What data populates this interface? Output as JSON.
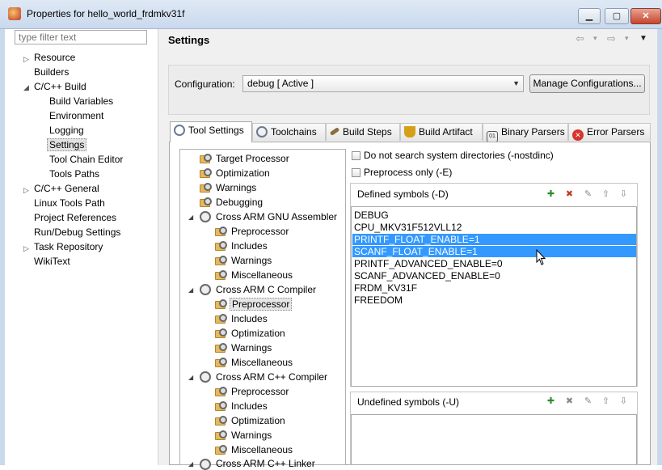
{
  "window": {
    "title": "Properties for hello_world_frdmkv31f",
    "min_glyph": "▁",
    "max_glyph": "▢",
    "close_glyph": "✕"
  },
  "sidebar": {
    "filter_placeholder": "type filter text",
    "items": [
      {
        "label": "Resource",
        "twisty": "▷"
      },
      {
        "label": "Builders"
      },
      {
        "label": "C/C++ Build",
        "twisty": "◢"
      },
      {
        "label": "Build Variables"
      },
      {
        "label": "Environment"
      },
      {
        "label": "Logging"
      },
      {
        "label": "Settings"
      },
      {
        "label": "Tool Chain Editor"
      },
      {
        "label": "Tools Paths"
      },
      {
        "label": "C/C++ General",
        "twisty": "▷"
      },
      {
        "label": "Linux Tools Path"
      },
      {
        "label": "Project References"
      },
      {
        "label": "Run/Debug Settings"
      },
      {
        "label": "Task Repository",
        "twisty": "▷"
      },
      {
        "label": "WikiText"
      }
    ]
  },
  "header": {
    "title": "Settings",
    "back_glyph": "⇦",
    "forward_glyph": "⇨",
    "dropdown_glyph": "▾",
    "menu_glyph": "▼"
  },
  "configuration": {
    "label": "Configuration:",
    "selected": "debug  [ Active ]",
    "manage_label": "Manage Configurations..."
  },
  "tabs": [
    {
      "label": "Tool Settings",
      "icon": "gear-icon",
      "color": "#6b7a8f"
    },
    {
      "label": "Toolchains",
      "icon": "gear-icon",
      "color": "#6b7a8f"
    },
    {
      "label": "Build Steps",
      "icon": "hammer-icon",
      "color": "#8c6d3f"
    },
    {
      "label": "Build Artifact",
      "icon": "trophy-icon",
      "color": "#d4a017"
    },
    {
      "label": "Binary Parsers",
      "icon": "binary-icon",
      "color": "#555555"
    },
    {
      "label": "Error Parsers",
      "icon": "error-icon",
      "color": "#d9342b"
    }
  ],
  "tool_tree": [
    {
      "label": "Target Processor"
    },
    {
      "label": "Optimization"
    },
    {
      "label": "Warnings"
    },
    {
      "label": "Debugging"
    },
    {
      "label": "Cross ARM GNU Assembler"
    },
    {
      "label": "Preprocessor"
    },
    {
      "label": "Includes"
    },
    {
      "label": "Warnings"
    },
    {
      "label": "Miscellaneous"
    },
    {
      "label": "Cross ARM C Compiler"
    },
    {
      "label": "Preprocessor"
    },
    {
      "label": "Includes"
    },
    {
      "label": "Optimization"
    },
    {
      "label": "Warnings"
    },
    {
      "label": "Miscellaneous"
    },
    {
      "label": "Cross ARM C++ Compiler"
    },
    {
      "label": "Preprocessor"
    },
    {
      "label": "Includes"
    },
    {
      "label": "Optimization"
    },
    {
      "label": "Warnings"
    },
    {
      "label": "Miscellaneous"
    },
    {
      "label": "Cross ARM C++ Linker"
    }
  ],
  "options": {
    "nostdinc_label": "Do not search system directories (-nostdinc)",
    "preprocess_only_label": "Preprocess only (-E)"
  },
  "defined_symbols": {
    "title": "Defined symbols (-D)",
    "items": [
      "DEBUG",
      "CPU_MKV31F512VLL12",
      "PRINTF_FLOAT_ENABLE=1",
      "SCANF_FLOAT_ENABLE=1",
      "PRINTF_ADVANCED_ENABLE=0",
      "SCANF_ADVANCED_ENABLE=0",
      "FRDM_KV31F",
      "FREEDOM"
    ],
    "selected_color": "#3399ff"
  },
  "undefined_symbols": {
    "title": "Undefined symbols (-U)"
  },
  "toolbar_glyphs": {
    "add": "✚",
    "delete": "✖",
    "edit": "✎",
    "up": "⇧",
    "down": "⇩"
  }
}
